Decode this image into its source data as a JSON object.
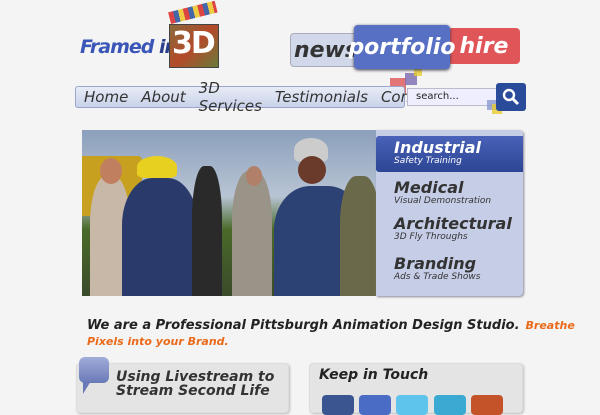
{
  "logo": {
    "framed": "Framed",
    "in": "in",
    "three_d": "3D"
  },
  "top_tabs": [
    {
      "label": "news"
    },
    {
      "label": "portfolio"
    },
    {
      "label": "hire"
    }
  ],
  "nav": {
    "items": [
      {
        "label": "Home"
      },
      {
        "label": "About"
      },
      {
        "label": "3D Services"
      },
      {
        "label": "Testimonials"
      },
      {
        "label": "Contact"
      }
    ]
  },
  "search": {
    "placeholder": "search..."
  },
  "services": [
    {
      "title": "Industrial",
      "subtitle": "Safety Training"
    },
    {
      "title": "Medical",
      "subtitle": "Visual Demonstration"
    },
    {
      "title": "Architectural",
      "subtitle": "3D Fly Throughs"
    },
    {
      "title": "Branding",
      "subtitle": "Ads & Trade Shows"
    }
  ],
  "tagline": {
    "main": "We are a Professional Pittsburgh Animation Design Studio.",
    "accent": "Breathe Pixels into your Brand."
  },
  "blog": {
    "title": "Using Livestream to Stream Second Life"
  },
  "touch": {
    "title": "Keep in Touch"
  },
  "social_colors": [
    "#3b5590",
    "#4a6cc4",
    "#5ec4ec",
    "#3aaad2",
    "#c4532a"
  ]
}
